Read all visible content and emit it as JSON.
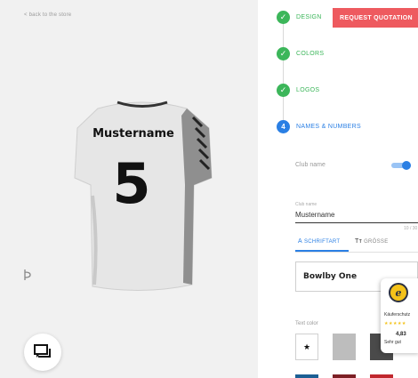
{
  "viewer": {
    "back_link": "< back to the store",
    "jersey": {
      "name": "Mustername",
      "number": "5"
    },
    "icons": {
      "rotate": "rotate-icon",
      "chat": "chat-icon"
    }
  },
  "steps": [
    {
      "label": "DESIGN",
      "status": "done"
    },
    {
      "label": "COLORS",
      "status": "done"
    },
    {
      "label": "LOGOS",
      "status": "done"
    },
    {
      "label": "NAMES & NUMBERS",
      "status": "active",
      "number": "4"
    }
  ],
  "quote_button": "REQUEST QUOTATION",
  "club_name": {
    "label": "Club name",
    "enabled": true
  },
  "name_field": {
    "label": "Club name",
    "value": "Mustername",
    "counter": "10 / 30"
  },
  "tabs": [
    {
      "icon_text": "A",
      "label": "SCHRIFTART",
      "active": true
    },
    {
      "icon_text": "Tт",
      "label": "GRÖSSE",
      "active": false
    }
  ],
  "font_select": {
    "value": "Bowlby One"
  },
  "text_color": {
    "label": "Text color",
    "swatches": [
      "#ffffff",
      "#bdbdbd",
      "#4a4a4a"
    ],
    "selected_index": 0,
    "row2": [
      "#1c5f94",
      "#7c1f24",
      "#c0272d"
    ]
  },
  "trust_badge": {
    "logo": "e",
    "line1": "Käuferschutz",
    "stars": "★★★★★",
    "score": "4,83",
    "line2": "Sehr gut"
  },
  "colors": {
    "success": "#3cb65a",
    "accent": "#2a7fe4",
    "quote": "#ee5a5f"
  }
}
